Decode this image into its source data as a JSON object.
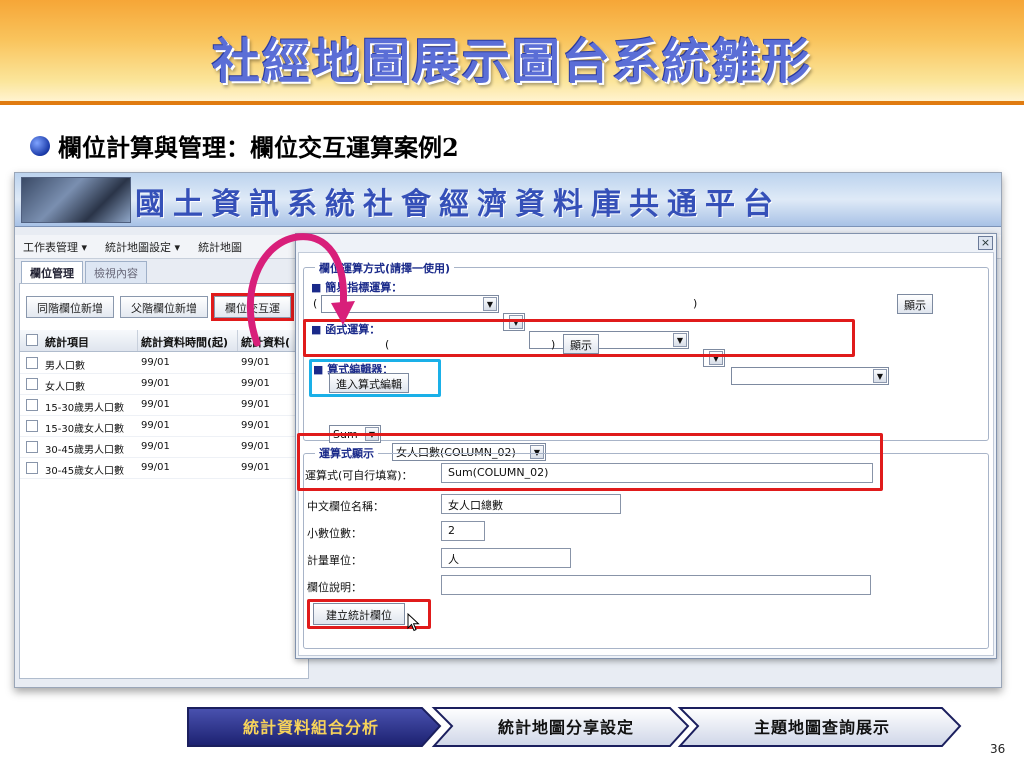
{
  "slide": {
    "title": "社經地圖展示圖台系統雛形",
    "heading": "欄位計算與管理：欄位交互運算案例2",
    "page_number": "36"
  },
  "app": {
    "title": "國土資訊系統社會經濟資料庫共通平台",
    "toolbar": [
      "工作表管理 ▾",
      "統計地圖設定 ▾",
      "統計地圖"
    ],
    "tabs": [
      "欄位管理",
      "檢視內容"
    ],
    "left_buttons": [
      "同階欄位新增",
      "父階欄位新增",
      "欄位交互運"
    ],
    "grid_headers": [
      "統計項目",
      "統計資料時間(起)",
      "統計資料("
    ],
    "grid_rows": [
      {
        "item": "男人口數",
        "start": "99/01",
        "end": "99/01"
      },
      {
        "item": "女人口數",
        "start": "99/01",
        "end": "99/01"
      },
      {
        "item": "15-30歲男人口數",
        "start": "99/01",
        "end": "99/01"
      },
      {
        "item": "15-30歲女人口數",
        "start": "99/01",
        "end": "99/01"
      },
      {
        "item": "30-45歲男人口數",
        "start": "99/01",
        "end": "99/01"
      },
      {
        "item": "30-45歲女人口數",
        "start": "99/01",
        "end": "99/01"
      }
    ]
  },
  "dialog": {
    "close": "×",
    "calc_legend": "欄位運算方式(請擇一使用)",
    "simple_label": "■ 簡易指標運算：",
    "simple_paren_open": "(",
    "simple_paren_close": ")",
    "show_button": "顯示",
    "func_label": "■ 函式運算：",
    "func_select": "Sum",
    "func_paren_open": "(",
    "func_column": "女人口數(COLUMN_02)",
    "func_paren_close": ")",
    "func_show_button": "顯示",
    "editor_label": "■ 算式編輯器：",
    "editor_button": "進入算式編輯",
    "display_legend": "運算式顯示",
    "expr_label": "運算式(可自行填寫)：",
    "expr_value": "Sum(COLUMN_02)",
    "name_label": "中文欄位名稱：",
    "name_value": "女人口總數",
    "decimal_label": "小數位數：",
    "decimal_value": "2",
    "unit_label": "計量單位：",
    "unit_value": "人",
    "desc_label": "欄位說明：",
    "desc_value": "",
    "create_button": "建立統計欄位"
  },
  "footer": {
    "steps": [
      "統計資料組合分析",
      "統計地圖分享設定",
      "主題地圖查詢展示"
    ]
  },
  "colors": {
    "highlight_red": "#e01b1b",
    "highlight_blue": "#1ab0e8",
    "arrow_magenta": "#d81f7a",
    "step_active_bg": "#2a2f8a",
    "step_active_text": "#f7d35a"
  }
}
